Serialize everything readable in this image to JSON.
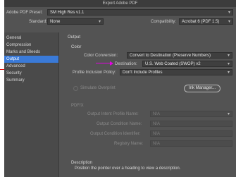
{
  "window": {
    "title": "Export Adobe PDF"
  },
  "header": {
    "preset_label": "Adobe PDF Preset:",
    "preset_value": "SM High Res v1.1",
    "standard_label": "Standard:",
    "standard_value": "None",
    "compat_label": "Compatibility:",
    "compat_value": "Acrobat 6 (PDF 1.5)"
  },
  "sidebar": {
    "items": [
      {
        "label": "General"
      },
      {
        "label": "Compression"
      },
      {
        "label": "Marks and Bleeds"
      },
      {
        "label": "Output"
      },
      {
        "label": "Advanced"
      },
      {
        "label": "Security"
      },
      {
        "label": "Summary"
      }
    ]
  },
  "output": {
    "section": "Output",
    "color_section": "Color",
    "color_conversion_label": "Color Conversion:",
    "color_conversion_value": "Convert to Destination (Preserve Numbers)",
    "destination_label": "Destination:",
    "destination_value": "U.S. Web Coated (SWOP) v2",
    "profile_policy_label": "Profile Inclusion Policy:",
    "profile_policy_value": "Don't Include Profiles",
    "simulate_overprint": "Simulate Overprint",
    "ink_manager": "Ink Manager..."
  },
  "pdfx": {
    "section": "PDF/X",
    "intent_label": "Output Intent Profile Name:",
    "intent_value": "N/A",
    "condition_name_label": "Output Condition Name:",
    "condition_name_value": "N/A",
    "condition_id_label": "Output Condition Identifier:",
    "condition_id_value": "N/A",
    "registry_label": "Registry Name:",
    "registry_value": "N/A"
  },
  "description": {
    "title": "Description",
    "text": "Position the pointer over a heading to view a description."
  },
  "colors": {
    "selection": "#3a7ad8",
    "window_bg": "#535353",
    "annotation_arrow": "#e600e6",
    "annotation_line": "#e60000"
  }
}
